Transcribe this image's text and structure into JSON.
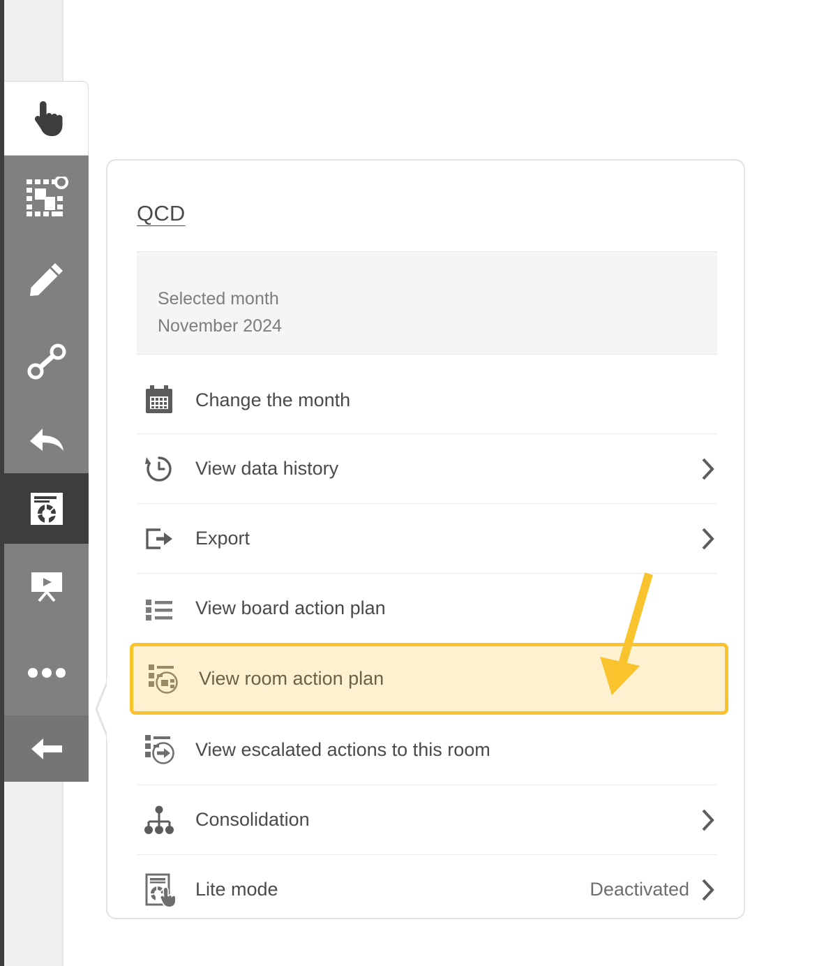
{
  "colors": {
    "accent_highlight_border": "#f9c32e",
    "accent_highlight_fill": "#fdf1d0",
    "annotation_arrow": "#f9c32e",
    "toolbar_inactive": "#808080",
    "toolbar_active": "#3d3d3d",
    "panel_border": "#e2e2e2",
    "text_primary": "#4a4a4a",
    "text_muted": "#7d7d7d"
  },
  "toolbar": {
    "items": [
      {
        "name": "cursor-tool",
        "icon": "pointer-hand-icon",
        "state": "light",
        "tooltip": "Select"
      },
      {
        "name": "select-objects-tool",
        "icon": "marquee-select-icon",
        "state": "normal",
        "tooltip": "Select objects"
      },
      {
        "name": "draw-tool",
        "icon": "pencil-icon",
        "state": "normal",
        "tooltip": "Draw"
      },
      {
        "name": "link-tool",
        "icon": "link-nodes-icon",
        "state": "normal",
        "tooltip": "Link"
      },
      {
        "name": "undo-tool",
        "icon": "undo-arrow-icon",
        "state": "normal",
        "tooltip": "Undo"
      },
      {
        "name": "board-tool",
        "icon": "board-chart-icon",
        "state": "active",
        "tooltip": "Board"
      },
      {
        "name": "presentation-tool",
        "icon": "presentation-icon",
        "state": "normal",
        "tooltip": "Presentation"
      },
      {
        "name": "more-tool",
        "icon": "ellipsis-icon",
        "state": "normal",
        "tooltip": "More"
      },
      {
        "name": "back-tool",
        "icon": "arrow-left-icon",
        "state": "dim",
        "tooltip": "Back"
      }
    ]
  },
  "panel": {
    "title": "QCD",
    "month": {
      "label": "Selected month",
      "value": "November 2024"
    },
    "items": [
      {
        "key": "change-the-month",
        "label": "Change the month",
        "icon": "calendar-icon",
        "chevron": false,
        "value": null,
        "separator_above": false,
        "highlighted": false
      },
      {
        "key": "view-data-history",
        "label": "View data history",
        "icon": "history-clock-icon",
        "chevron": true,
        "value": null,
        "separator_above": true,
        "highlighted": false
      },
      {
        "key": "export",
        "label": "Export",
        "icon": "export-arrow-icon",
        "chevron": true,
        "value": null,
        "separator_above": true,
        "highlighted": false
      },
      {
        "key": "view-board-action-plan",
        "label": "View board action plan",
        "icon": "bullet-list-icon",
        "chevron": false,
        "value": null,
        "separator_above": true,
        "highlighted": false
      },
      {
        "key": "view-room-action-plan",
        "label": "View room action plan",
        "icon": "room-action-plan-icon",
        "chevron": false,
        "value": null,
        "separator_above": false,
        "highlighted": true
      },
      {
        "key": "view-escalated-actions-to-this-room",
        "label": "View escalated actions to this room",
        "icon": "escalated-actions-icon",
        "chevron": false,
        "value": null,
        "separator_above": false,
        "highlighted": false
      },
      {
        "key": "consolidation",
        "label": "Consolidation",
        "icon": "hierarchy-icon",
        "chevron": true,
        "value": null,
        "separator_above": true,
        "highlighted": false
      },
      {
        "key": "lite-mode",
        "label": "Lite mode",
        "icon": "lite-mode-icon",
        "chevron": true,
        "value": "Deactivated",
        "separator_above": true,
        "highlighted": false
      }
    ]
  },
  "annotation": {
    "type": "arrow",
    "points_to": "view-room-action-plan",
    "color": "#f9c32e"
  }
}
